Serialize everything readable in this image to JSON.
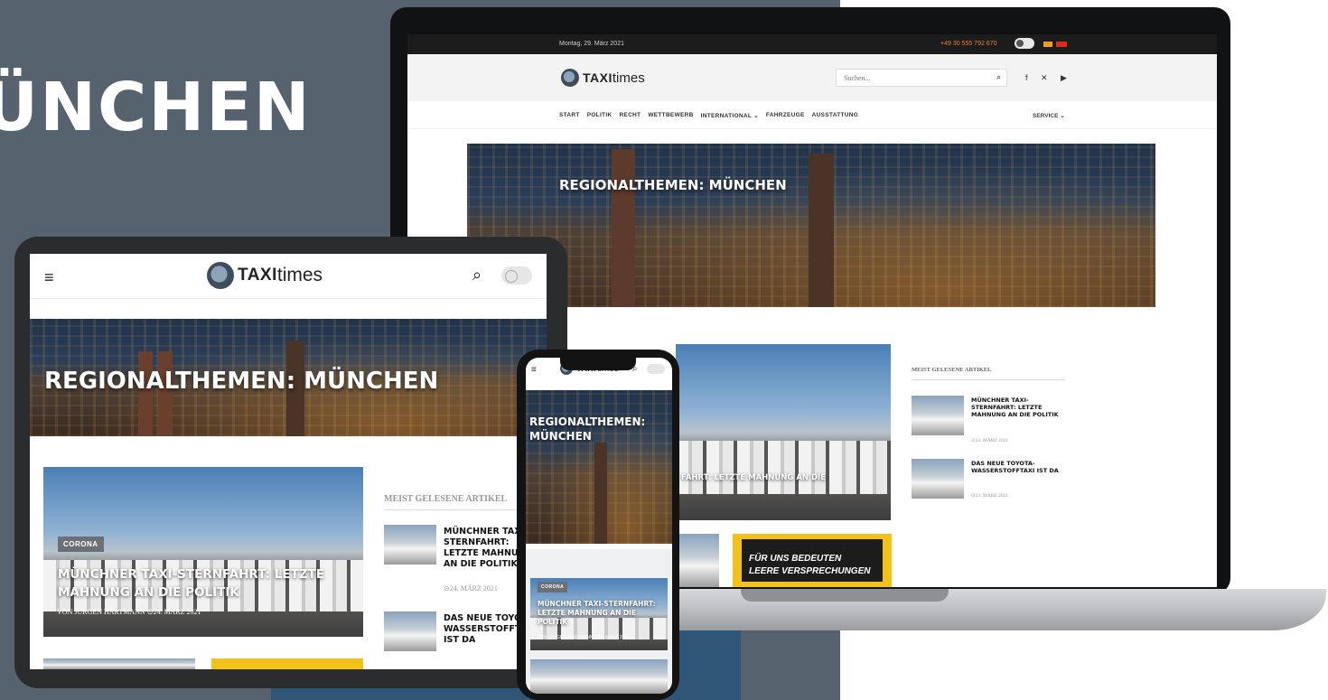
{
  "colors": {
    "slate": "#56626d",
    "blue": "#2f5677",
    "phone_orange": "#e8833a",
    "badge_grey": "#6b7077",
    "yellow": "#f2c218"
  },
  "banner": {
    "title": "ÜNCHEN"
  },
  "brand": {
    "logo_bold": "TAXI",
    "logo_light": "times"
  },
  "desktop": {
    "date": "Montag, 29. März 2021",
    "phone": "+49 30 555 792 670",
    "search_placeholder": "Suchen...",
    "social": "f  ✕  ▶",
    "nav": [
      "START",
      "POLITIK",
      "RECHT",
      "WETTBEWERB",
      "INTERNATIONAL ⌄",
      "FAHRZEUGE",
      "AUSSTATTUNG"
    ],
    "service": "SERVICE ⌄",
    "hero_title": "REGIONALTHEMEN: MÜNCHEN",
    "featured_title_partial": "FAHRT: LETZTE MAHNUNG AN DIE",
    "yellow_text": "FÜR UNS BEDEUTEN",
    "yellow_text2": "LEERE VERSPRECHUNGEN",
    "sidebar_title": "MEIST GELESENE ARTIKEL",
    "sidebar": [
      {
        "title": "MÜNCHNER TAXI-STERNFAHRT: LETZTE MAHNUNG AN DIE POLITIK",
        "date": "⊙24. MÄRZ 2021"
      },
      {
        "title": "DAS NEUE TOYOTA-WASSERSTOFFTAXI IST DA",
        "date": "⊙23. MÄRZ 2021"
      }
    ]
  },
  "tablet": {
    "menu_icon": "≡",
    "search_icon": "⌕",
    "hero_title": "REGIONALTHEMEN: MÜNCHEN",
    "badge": "CORONA",
    "featured_title_1": "MÜNCHNER TAXI-STERNFAHRT: LETZTE",
    "featured_title_2": "MAHNUNG AN DIE POLITIK",
    "byline": "VON JÜRGEN HARTMANN   ⊙24. MÄRZ 2021",
    "sidebar_title": "MEIST GELESENE ARTIKEL",
    "sidebar": [
      {
        "title": "MÜNCHNER TAXI-STERNFAHRT: LETZTE MAHNUNG AN DIE POLITIK",
        "date": "⊙24. MÄRZ 2021"
      },
      {
        "title": "DAS NEUE TOYOTA-WASSERSTOFFTAXI IST DA",
        "date": ""
      }
    ]
  },
  "phone": {
    "menu_icon": "≡",
    "search_icon": "⌕",
    "hero_title_1": "REGIONALTHEMEN:",
    "hero_title_2": "MÜNCHEN",
    "badge": "CORONA",
    "featured_title": "MÜNCHNER TAXI-STERNFAHRT: LETZTE MAHNUNG AN DIE POLITIK",
    "byline": "VON JÜRGEN HARTMANN   ⊙24. MÄRZ 2021"
  }
}
